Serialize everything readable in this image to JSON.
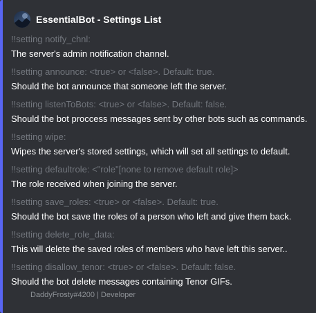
{
  "embed": {
    "accent_color": "#5865f2",
    "author": {
      "avatar_icon": "bot-avatar-icon",
      "name": "EssentialBot - Settings List"
    },
    "fields": [
      {
        "name": "!!setting notify_chnl:",
        "value": "The server's admin notification channel."
      },
      {
        "name": "!!setting announce: <true> or <false>. Default: true.",
        "value": "Should the bot announce that someone left the server."
      },
      {
        "name": "!!setting listenToBots: <true> or <false>. Default: false.",
        "value": "Should the bot proccess messages sent by other bots such as commands."
      },
      {
        "name": "!!setting wipe:",
        "value": "Wipes the server's stored settings, which will set all settings to default."
      },
      {
        "name": "!!setting defaultrole: <\"role\"[none to remove default role]>",
        "value": "The role received when joining the server."
      },
      {
        "name": "!!setting save_roles: <true> or <false>. Default: true.",
        "value": "Should the bot save the roles of a person who left and give them back."
      },
      {
        "name": "!!setting delete_role_data:",
        "value": "This will delete the saved roles of members who have left this server.."
      },
      {
        "name": "!!setting disallow_tenor: <true> or <false>. Default: false.",
        "value": "Should the bot delete messages containing Tenor GIFs."
      }
    ],
    "footer": "DaddyFrosty#4200 | Developer"
  }
}
